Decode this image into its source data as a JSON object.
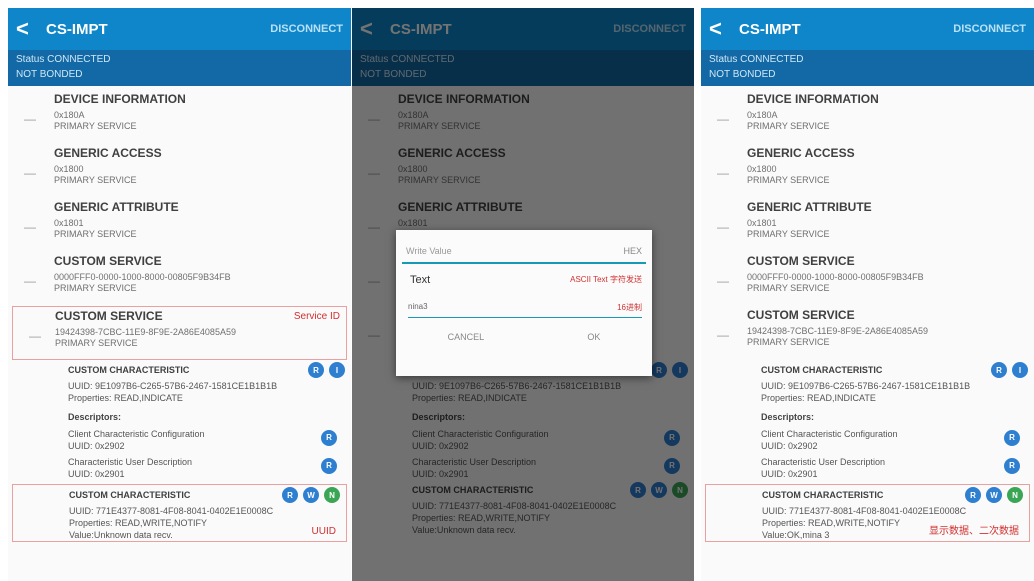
{
  "app": {
    "back_symbol": "<",
    "title": "CS-IMPT",
    "action_label": "DISCONNECT",
    "status": "Status CONNECTED",
    "bond": "NOT BONDED"
  },
  "services": [
    {
      "name": "DEVICE INFORMATION",
      "uuid": "0x180A",
      "type": "PRIMARY SERVICE"
    },
    {
      "name": "GENERIC ACCESS",
      "uuid": "0x1800",
      "type": "PRIMARY SERVICE"
    },
    {
      "name": "GENERIC ATTRIBUTE",
      "uuid": "0x1801",
      "type": "PRIMARY SERVICE"
    },
    {
      "name": "CUSTOM SERVICE",
      "uuid": "0000FFF0-0000-1000-8000-00805F9B34FB",
      "type": "PRIMARY SERVICE"
    },
    {
      "name": "CUSTOM SERVICE",
      "uuid": "19424398-7CBC-11E9-8F9E-2A86E4085A59",
      "type": "PRIMARY SERVICE",
      "tag": "Service ID"
    }
  ],
  "characteristics": [
    {
      "name": "CUSTOM CHARACTERISTIC",
      "uuid": "UUID: 9E1097B6-C265-57B6-2467-1581CE1B1B1B",
      "props": "Properties: READ,INDICATE",
      "buttons": [
        "R",
        "I"
      ],
      "descriptors_heading": "Descriptors:",
      "descriptors": [
        {
          "name": "Client Characteristic Configuration",
          "uuid": "UUID: 0x2902",
          "btn": "R"
        },
        {
          "name": "Characteristic User Description",
          "uuid": "UUID: 0x2901",
          "btn": "R"
        }
      ]
    },
    {
      "name": "CUSTOM CHARACTERISTIC",
      "uuid": "UUID: 771E4377-8081-4F08-8041-0402E1E0008C",
      "props": "Properties: READ,WRITE,NOTIFY",
      "value_left": "Value:Unknown data recv.",
      "note": "UUID",
      "buttons": [
        "R",
        "W",
        "N"
      ]
    }
  ],
  "panel3_char": {
    "uuid": "UUID: 771E4377-8081-4F08-8041-0402E1E0008C",
    "props": "Properties: READ,WRITE,NOTIFY",
    "value": "Value:OK,mina 3",
    "note": "显示数据、二次数据"
  },
  "dialog": {
    "title": "Write Value",
    "hint": "HEX",
    "row_label": "Text",
    "row_opts": "ASCII  Text    字符发送",
    "input_label": "nina3",
    "input_value": "16进制",
    "cancel": "CANCEL",
    "ok": "OK"
  },
  "colors": {
    "appbar": "#0f86c9",
    "statusbar": "#1369a5",
    "accent_red": "#d32f2f",
    "button_blue": "#2f7fd1",
    "button_green": "#3aa655"
  }
}
